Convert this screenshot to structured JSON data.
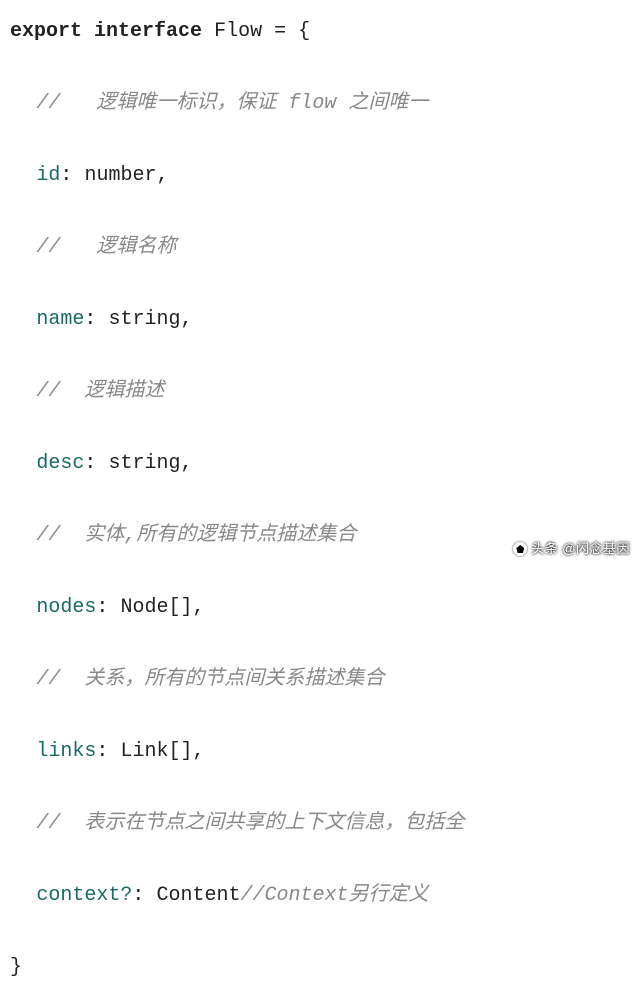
{
  "code": {
    "line1_kw1": "export",
    "line1_kw2": "interface",
    "line1_name": "Flow",
    "line1_eq": "=",
    "line1_brace": "{",
    "comment_id": "//   逻辑唯一标识，保证 flow 之间唯一",
    "prop_id": "id",
    "colon": ":",
    "type_number": "number",
    "comma": ",",
    "comment_name": "//   逻辑名称",
    "prop_name": "name",
    "type_string": "string",
    "comment_desc": "//  逻辑描述",
    "prop_desc": "desc",
    "comment_nodes": "//  实体,所有的逻辑节点描述集合",
    "prop_nodes": "nodes",
    "type_node_arr": "Node[]",
    "comment_links": "//  关系，所有的节点间关系描述集合",
    "prop_links": "links",
    "type_link_arr": "Link[]",
    "comment_context": "//  表示在节点之间共享的上下文信息，包括全",
    "prop_context": "context?",
    "type_content": "Content",
    "inline_comment_context": "//Context另行定义",
    "close_brace": "}"
  },
  "watermark": {
    "label": "头条",
    "handle": "@闪念基因"
  }
}
